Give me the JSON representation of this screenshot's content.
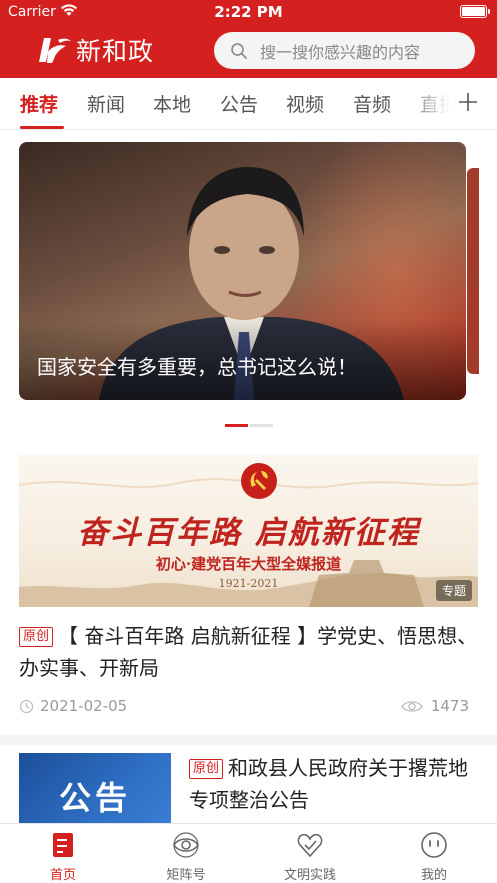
{
  "status_bar": {
    "carrier": "Carrier",
    "time": "2:22 PM"
  },
  "header": {
    "app_name": "新和政",
    "search_placeholder": "搜一搜你感兴趣的内容"
  },
  "tabs": [
    "推荐",
    "新闻",
    "本地",
    "公告",
    "视频",
    "音频",
    "直播"
  ],
  "active_tab": "推荐",
  "carousel": {
    "caption": "国家安全有多重要，总书记这么说！",
    "page_count": 2,
    "active_index": 0
  },
  "featured": {
    "banner_headline": "奋斗百年路 启航新征程",
    "banner_subtitle": "初心·建党百年大型全媒报道",
    "banner_years": "1921-2021",
    "banner_tag": "专题",
    "badge": "原创",
    "title": "【 奋斗百年路 启航新征程 】学党史、悟思想、办实事、开新局",
    "date": "2021-02-05",
    "views": "1473"
  },
  "article2": {
    "thumb_text": "公告",
    "badge": "原创",
    "title": "和政县人民政府关于撂荒地专项整治公告"
  },
  "bottom_nav": [
    {
      "label": "首页",
      "icon": "home-icon",
      "active": true
    },
    {
      "label": "矩阵号",
      "icon": "eye-icon",
      "active": false
    },
    {
      "label": "文明实践",
      "icon": "heart-icon",
      "active": false
    },
    {
      "label": "我的",
      "icon": "smiley-icon",
      "active": false
    }
  ],
  "colors": {
    "brand_red": "#d4211f"
  }
}
